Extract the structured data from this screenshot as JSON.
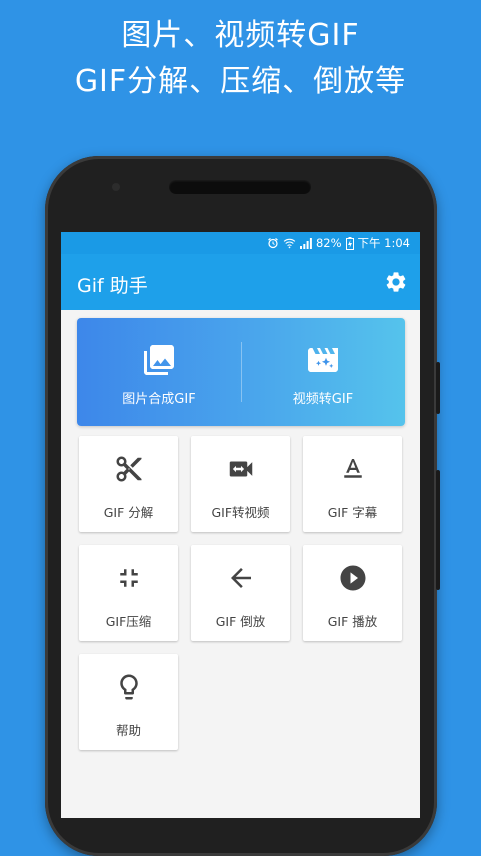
{
  "promo": {
    "line1": "图片、视频转GIF",
    "line2": "GIF分解、压缩、倒放等"
  },
  "status_bar": {
    "battery": "82%",
    "time": "下午 1:04",
    "icons": [
      "alarm-icon",
      "wifi-icon",
      "signal-icon",
      "battery-charging-icon"
    ]
  },
  "app_bar": {
    "title": "Gif 助手",
    "settings_icon": "gear-icon"
  },
  "hero": [
    {
      "label": "图片合成GIF",
      "icon": "image-icon"
    },
    {
      "label": "视频转GIF",
      "icon": "video-sparkle-icon"
    }
  ],
  "tools": [
    {
      "label": "GIF 分解",
      "icon": "scissors-icon"
    },
    {
      "label": "GIF转视频",
      "icon": "video-convert-icon"
    },
    {
      "label": "GIF 字幕",
      "icon": "text-format-icon"
    },
    {
      "label": "GIF压缩",
      "icon": "compress-icon"
    },
    {
      "label": "GIF 倒放",
      "icon": "arrow-left-icon"
    },
    {
      "label": "GIF 播放",
      "icon": "play-circle-icon"
    },
    {
      "label": "帮助",
      "icon": "lightbulb-icon"
    }
  ],
  "colors": {
    "background": "#2f93e6",
    "app_bar": "#1ea0ea",
    "status_bar": "#1a9ae6",
    "hero_start": "#3d87ea",
    "hero_end": "#55c3ec",
    "icon": "#444444"
  }
}
